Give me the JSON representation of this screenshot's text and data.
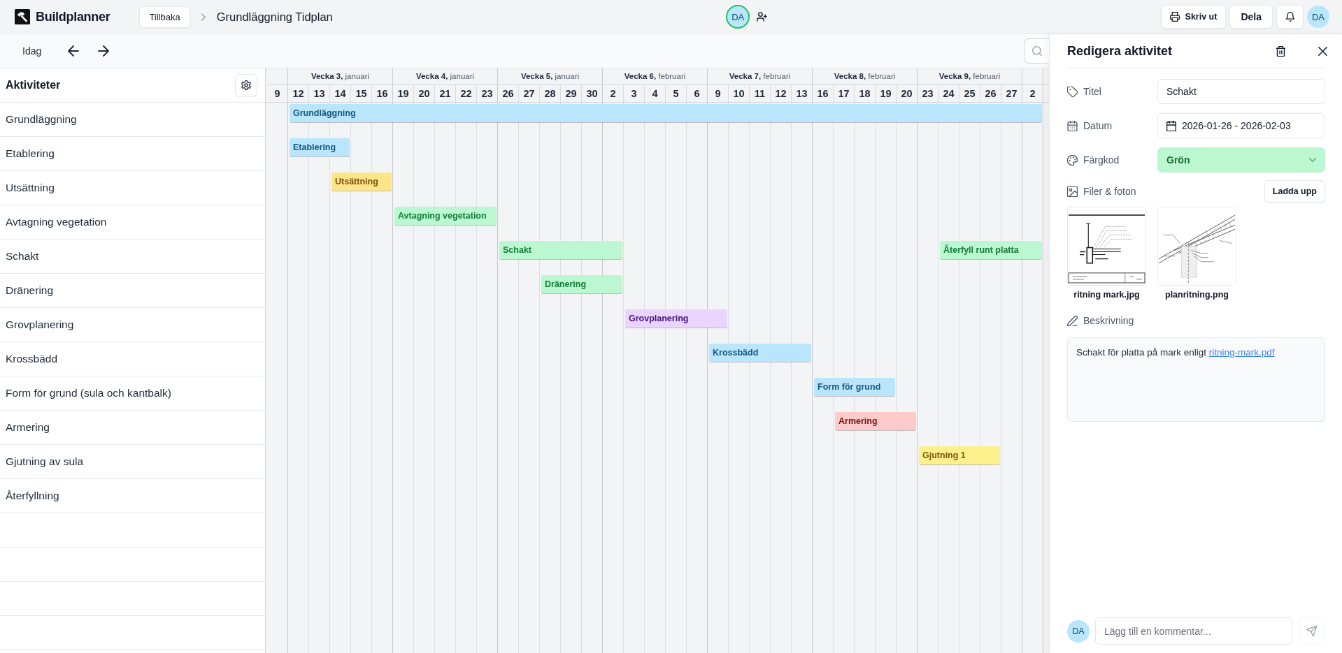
{
  "header": {
    "logo": "Buildplanner",
    "back_button": "Tillbaka",
    "title": "Grundläggning Tidplan",
    "collaborators": [
      {
        "initials": "DA",
        "online": true
      }
    ],
    "actions": [
      {
        "kind": "print",
        "label": "Skriv ut"
      },
      {
        "kind": "share",
        "label": "Dela"
      },
      {
        "kind": "notifications"
      }
    ],
    "user": {
      "initials": "DA"
    }
  },
  "toolbar": {
    "today_button": "Idag"
  },
  "activities": {
    "title": "Aktiviteter",
    "rows": [
      {
        "name": "Grundläggning",
        "bars": [
          {
            "label": "Grundläggning",
            "color": "#bae6fd"
          }
        ]
      },
      {
        "name": "Etablering",
        "bars": [
          {
            "label": "Etablering",
            "color": "#bae6fd"
          }
        ]
      },
      {
        "name": "Utsättning",
        "bars": [
          {
            "label": "Utsättning",
            "color": "#fde68a"
          }
        ]
      },
      {
        "name": "Avtagning vegetation",
        "bars": [
          {
            "label": "Avtagning vegetation",
            "color": "#bbf7d0"
          }
        ]
      },
      {
        "name": "Schakt",
        "bars": [
          {
            "label": "Schakt",
            "color": "#bbf7d0"
          },
          {
            "label": "Återfyll runt platta",
            "color": "#bbf7d0"
          }
        ]
      },
      {
        "name": "Dränering",
        "bars": [
          {
            "label": "Dränering",
            "color": "#bbf7d0"
          }
        ]
      },
      {
        "name": "Grovplanering",
        "bars": [
          {
            "label": "Grovplanering",
            "color": "#e9d5ff"
          }
        ]
      },
      {
        "name": "Krossbädd",
        "bars": [
          {
            "label": "Krossbädd",
            "color": "#bae6fd"
          }
        ]
      },
      {
        "name": "Form för grund (sula och kantbalk)",
        "bars": [
          {
            "label": "Form för grund",
            "color": "#bae6fd"
          }
        ]
      },
      {
        "name": "Armering",
        "bars": [
          {
            "label": "Armering",
            "color": "#fecaca"
          }
        ]
      },
      {
        "name": "Gjutning av sula",
        "bars": [
          {
            "label": "Gjutning 1",
            "color": "#fef08a"
          }
        ]
      },
      {
        "name": "Återfyllning"
      }
    ]
  },
  "timeline": {
    "lead_days": [
      "9"
    ],
    "weeks": [
      {
        "label": "**Vecka 3,** januari",
        "days": [
          "12",
          "13",
          "14",
          "15",
          "16"
        ]
      },
      {
        "label": "**Vecka 4,** januari",
        "days": [
          "19",
          "20",
          "21",
          "22",
          "23"
        ]
      },
      {
        "label": "**Vecka 5,** januari",
        "days": [
          "26",
          "27",
          "28",
          "29",
          "30"
        ]
      },
      {
        "label": "**Vecka 6,** februari",
        "days": [
          "2",
          "3",
          "4",
          "5",
          "6"
        ]
      },
      {
        "label": "**Vecka 7,** februari",
        "days": [
          "9",
          "10",
          "11",
          "12",
          "13"
        ]
      },
      {
        "label": "**Vecka 8,** februari",
        "days": [
          "16",
          "17",
          "18",
          "19",
          "20"
        ]
      },
      {
        "label": "**Vecka 9,** februari",
        "days": [
          "23",
          "24",
          "25",
          "26",
          "27"
        ]
      },
      {
        "days": [
          "2"
        ]
      }
    ]
  },
  "panel": {
    "title": "Redigera aktivitet",
    "fields": [
      {
        "kind": "text",
        "label": "Titel",
        "value": "Schakt"
      },
      {
        "kind": "date",
        "label": "Datum",
        "value": "2026-01-26 - 2026-02-03"
      },
      {
        "kind": "select",
        "label": "Färgkod",
        "value": "Grön",
        "color": "#bbf7d0"
      }
    ],
    "files": {
      "label": "Filer & foton",
      "upload_button": "Ladda upp",
      "items": [
        {
          "name": "ritning mark.jpg"
        },
        {
          "name": "planritning.png"
        }
      ]
    },
    "description": {
      "label": "Beskrivning",
      "text": "Schakt för platta på mark enligt",
      "link": "ritning-mark.pdf"
    },
    "comment": {
      "initials": "DA",
      "placeholder": "Lägg till en kommentar...",
      "send_disabled": true
    }
  }
}
